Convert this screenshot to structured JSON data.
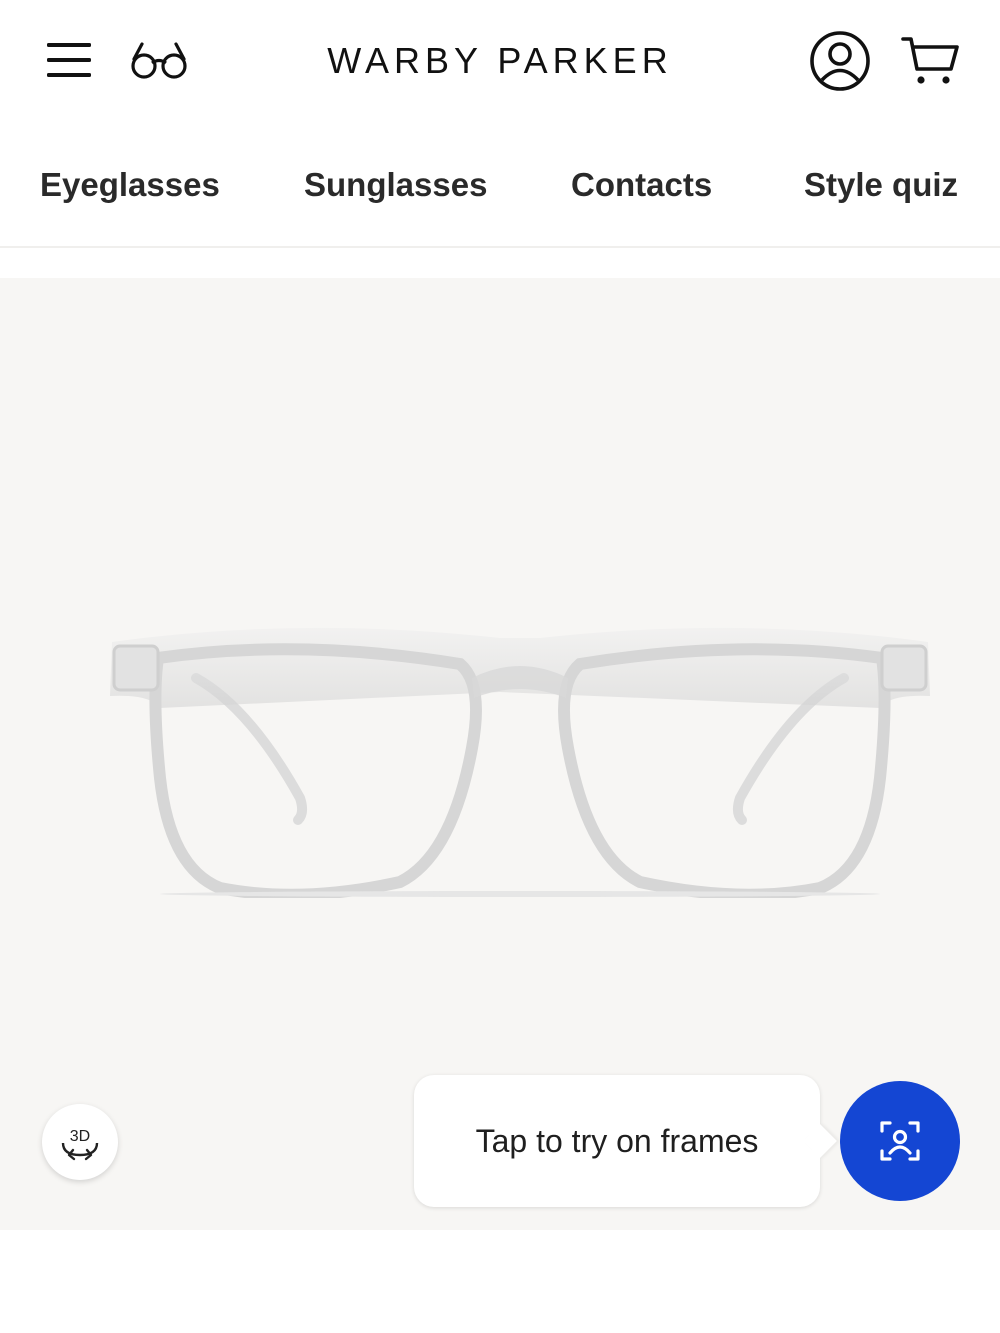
{
  "header": {
    "brand": "WARBY PARKER",
    "icons": {
      "menu": "hamburger-menu-icon",
      "glasses": "glasses-icon",
      "account": "account-icon",
      "cart": "cart-icon"
    }
  },
  "nav": {
    "items": [
      {
        "label": "Eyeglasses"
      },
      {
        "label": "Sunglasses"
      },
      {
        "label": "Contacts"
      },
      {
        "label": "Style quiz"
      }
    ]
  },
  "product": {
    "image": "clear-eyeglasses-frames",
    "view3d_label": "3D",
    "tryon_tooltip": "Tap to try on frames",
    "tryon_icon": "face-scan-icon"
  },
  "colors": {
    "accent": "#1446d3",
    "hero_background": "#f7f6f4"
  }
}
